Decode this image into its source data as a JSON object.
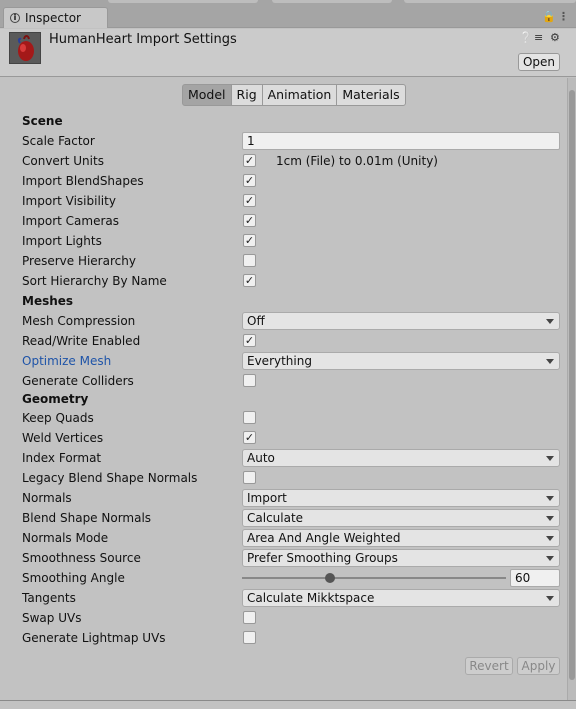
{
  "window": {
    "tab_label": "Inspector",
    "tab_icon": "info-icon",
    "lock_icon": "lock-icon",
    "menu_icon": "kebab-menu-icon"
  },
  "header": {
    "title": "HumanHeart Import Settings",
    "thumbnail": "heart-model-thumbnail",
    "help_icon": "help-icon",
    "preset_icon": "preset-sliders-icon",
    "settings_icon": "gear-icon",
    "open_label": "Open"
  },
  "mode_tabs": [
    "Model",
    "Rig",
    "Animation",
    "Materials"
  ],
  "active_tab": "Model",
  "scene": {
    "heading": "Scene",
    "scale_factor_label": "Scale Factor",
    "scale_factor_value": "1",
    "convert_units_label": "Convert Units",
    "convert_units_checked": true,
    "convert_units_note": "1cm (File) to 0.01m (Unity)",
    "import_blendshapes_label": "Import BlendShapes",
    "import_blendshapes_checked": true,
    "import_visibility_label": "Import Visibility",
    "import_visibility_checked": true,
    "import_cameras_label": "Import Cameras",
    "import_cameras_checked": true,
    "import_lights_label": "Import Lights",
    "import_lights_checked": true,
    "preserve_hierarchy_label": "Preserve Hierarchy",
    "preserve_hierarchy_checked": false,
    "sort_hierarchy_label": "Sort Hierarchy By Name",
    "sort_hierarchy_checked": true
  },
  "meshes": {
    "heading": "Meshes",
    "mesh_compression_label": "Mesh Compression",
    "mesh_compression_value": "Off",
    "read_write_label": "Read/Write Enabled",
    "read_write_checked": true,
    "optimize_mesh_label": "Optimize Mesh",
    "optimize_mesh_value": "Everything",
    "generate_colliders_label": "Generate Colliders",
    "generate_colliders_checked": false
  },
  "geometry": {
    "heading": "Geometry",
    "keep_quads_label": "Keep Quads",
    "keep_quads_checked": false,
    "weld_vertices_label": "Weld Vertices",
    "weld_vertices_checked": true,
    "index_format_label": "Index Format",
    "index_format_value": "Auto",
    "legacy_blend_label": "Legacy Blend Shape Normals",
    "legacy_blend_checked": false,
    "normals_label": "Normals",
    "normals_value": "Import",
    "blend_shape_normals_label": "Blend Shape Normals",
    "blend_shape_normals_value": "Calculate",
    "normals_mode_label": "Normals Mode",
    "normals_mode_value": "Area And Angle Weighted",
    "smoothness_source_label": "Smoothness Source",
    "smoothness_source_value": "Prefer Smoothing Groups",
    "smoothing_angle_label": "Smoothing Angle",
    "smoothing_angle_value": "60",
    "smoothing_angle_fraction": 0.333,
    "tangents_label": "Tangents",
    "tangents_value": "Calculate Mikktspace",
    "swap_uvs_label": "Swap UVs",
    "swap_uvs_checked": false,
    "generate_lightmap_label": "Generate Lightmap UVs",
    "generate_lightmap_checked": false
  },
  "footer": {
    "revert_label": "Revert",
    "apply_label": "Apply"
  },
  "colors": {
    "panel_bg": "#c2c2c2",
    "active_tab_bg": "#a4a4a4",
    "highlight_label": "#1f54a8"
  }
}
